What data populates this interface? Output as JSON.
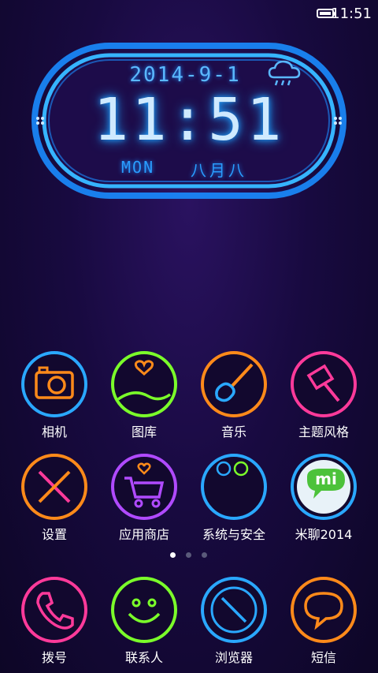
{
  "status_bar": {
    "time": "11:51",
    "icons": [
      "battery-icon"
    ]
  },
  "clock_widget": {
    "date": "2014-9-1",
    "time": "11:51",
    "weekday": "MON",
    "lunar_date": "八月八",
    "weather_icon": "cloud-rain-icon",
    "accent_color": "#1ea0ff"
  },
  "apps": [
    {
      "label": "相机",
      "icon": "camera-icon",
      "color": "#2aa8ff"
    },
    {
      "label": "图库",
      "icon": "gallery-icon",
      "color": "#7bff2a"
    },
    {
      "label": "音乐",
      "icon": "guitar-icon",
      "color": "#ff8a1a"
    },
    {
      "label": "主题风格",
      "icon": "brush-icon",
      "color": "#ff3a9a"
    },
    {
      "label": "设置",
      "icon": "tools-icon",
      "color": "#ff8a1a"
    },
    {
      "label": "应用商店",
      "icon": "cart-icon",
      "color": "#b04aff"
    },
    {
      "label": "系统与安全",
      "icon": "folder-icon",
      "color": "#2aa8ff"
    },
    {
      "label": "米聊2014",
      "icon": "miliao-icon",
      "color": "#2aa8ff"
    }
  ],
  "page_indicator": {
    "pages": 3,
    "current": 1
  },
  "dock": [
    {
      "label": "拨号",
      "icon": "phone-icon",
      "color": "#ff3a9a"
    },
    {
      "label": "联系人",
      "icon": "smiley-icon",
      "color": "#7bff2a"
    },
    {
      "label": "浏览器",
      "icon": "browser-icon",
      "color": "#2aa8ff"
    },
    {
      "label": "短信",
      "icon": "message-icon",
      "color": "#ff8a1a"
    }
  ]
}
